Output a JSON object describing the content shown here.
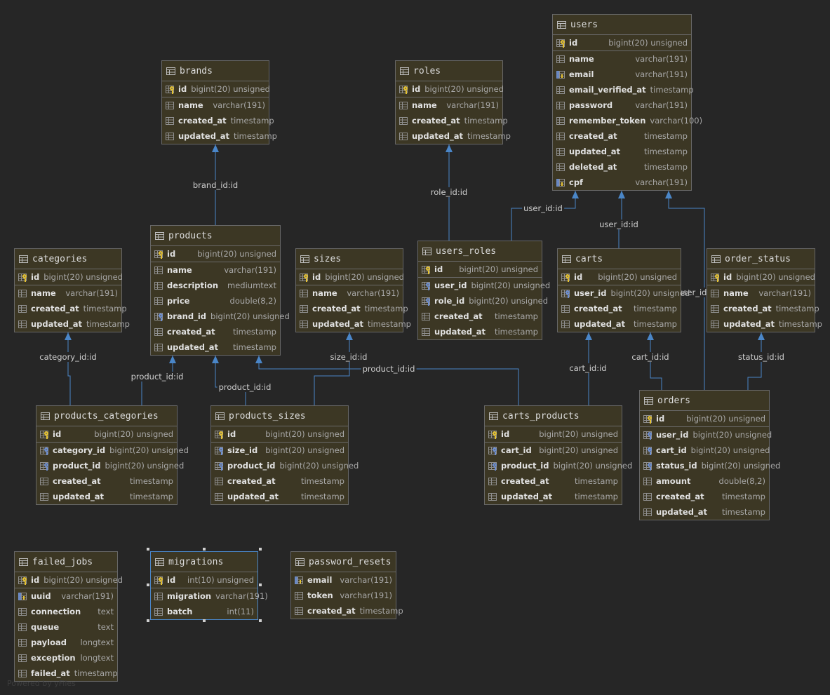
{
  "tables": {
    "users": {
      "name": "users",
      "columns": [
        {
          "name": "id",
          "type": "bigint(20) unsigned",
          "key": "pk"
        },
        {
          "name": "name",
          "type": "varchar(191)",
          "key": ""
        },
        {
          "name": "email",
          "type": "varchar(191)",
          "key": "idx"
        },
        {
          "name": "email_verified_at",
          "type": "timestamp",
          "key": ""
        },
        {
          "name": "password",
          "type": "varchar(191)",
          "key": ""
        },
        {
          "name": "remember_token",
          "type": "varchar(100)",
          "key": ""
        },
        {
          "name": "created_at",
          "type": "timestamp",
          "key": ""
        },
        {
          "name": "updated_at",
          "type": "timestamp",
          "key": ""
        },
        {
          "name": "deleted_at",
          "type": "timestamp",
          "key": ""
        },
        {
          "name": "cpf",
          "type": "varchar(191)",
          "key": "idx"
        }
      ]
    },
    "brands": {
      "name": "brands",
      "columns": [
        {
          "name": "id",
          "type": "bigint(20) unsigned",
          "key": "pk"
        },
        {
          "name": "name",
          "type": "varchar(191)",
          "key": ""
        },
        {
          "name": "created_at",
          "type": "timestamp",
          "key": ""
        },
        {
          "name": "updated_at",
          "type": "timestamp",
          "key": ""
        }
      ]
    },
    "roles": {
      "name": "roles",
      "columns": [
        {
          "name": "id",
          "type": "bigint(20) unsigned",
          "key": "pk"
        },
        {
          "name": "name",
          "type": "varchar(191)",
          "key": ""
        },
        {
          "name": "created_at",
          "type": "timestamp",
          "key": ""
        },
        {
          "name": "updated_at",
          "type": "timestamp",
          "key": ""
        }
      ]
    },
    "products": {
      "name": "products",
      "columns": [
        {
          "name": "id",
          "type": "bigint(20) unsigned",
          "key": "pk"
        },
        {
          "name": "name",
          "type": "varchar(191)",
          "key": ""
        },
        {
          "name": "description",
          "type": "mediumtext",
          "key": ""
        },
        {
          "name": "price",
          "type": "double(8,2)",
          "key": ""
        },
        {
          "name": "brand_id",
          "type": "bigint(20) unsigned",
          "key": "fk"
        },
        {
          "name": "created_at",
          "type": "timestamp",
          "key": ""
        },
        {
          "name": "updated_at",
          "type": "timestamp",
          "key": ""
        }
      ]
    },
    "categories": {
      "name": "categories",
      "columns": [
        {
          "name": "id",
          "type": "bigint(20) unsigned",
          "key": "pk"
        },
        {
          "name": "name",
          "type": "varchar(191)",
          "key": ""
        },
        {
          "name": "created_at",
          "type": "timestamp",
          "key": ""
        },
        {
          "name": "updated_at",
          "type": "timestamp",
          "key": ""
        }
      ]
    },
    "sizes": {
      "name": "sizes",
      "columns": [
        {
          "name": "id",
          "type": "bigint(20) unsigned",
          "key": "pk"
        },
        {
          "name": "name",
          "type": "varchar(191)",
          "key": ""
        },
        {
          "name": "created_at",
          "type": "timestamp",
          "key": ""
        },
        {
          "name": "updated_at",
          "type": "timestamp",
          "key": ""
        }
      ]
    },
    "users_roles": {
      "name": "users_roles",
      "columns": [
        {
          "name": "id",
          "type": "bigint(20) unsigned",
          "key": "pk"
        },
        {
          "name": "user_id",
          "type": "bigint(20) unsigned",
          "key": "fk"
        },
        {
          "name": "role_id",
          "type": "bigint(20) unsigned",
          "key": "fk"
        },
        {
          "name": "created_at",
          "type": "timestamp",
          "key": ""
        },
        {
          "name": "updated_at",
          "type": "timestamp",
          "key": ""
        }
      ]
    },
    "carts": {
      "name": "carts",
      "columns": [
        {
          "name": "id",
          "type": "bigint(20) unsigned",
          "key": "pk"
        },
        {
          "name": "user_id",
          "type": "bigint(20) unsigned",
          "key": "fk"
        },
        {
          "name": "created_at",
          "type": "timestamp",
          "key": ""
        },
        {
          "name": "updated_at",
          "type": "timestamp",
          "key": ""
        }
      ]
    },
    "order_status": {
      "name": "order_status",
      "columns": [
        {
          "name": "id",
          "type": "bigint(20) unsigned",
          "key": "pk"
        },
        {
          "name": "name",
          "type": "varchar(191)",
          "key": ""
        },
        {
          "name": "created_at",
          "type": "timestamp",
          "key": ""
        },
        {
          "name": "updated_at",
          "type": "timestamp",
          "key": ""
        }
      ]
    },
    "products_categories": {
      "name": "products_categories",
      "columns": [
        {
          "name": "id",
          "type": "bigint(20) unsigned",
          "key": "pk"
        },
        {
          "name": "category_id",
          "type": "bigint(20) unsigned",
          "key": "fk"
        },
        {
          "name": "product_id",
          "type": "bigint(20) unsigned",
          "key": "fk"
        },
        {
          "name": "created_at",
          "type": "timestamp",
          "key": ""
        },
        {
          "name": "updated_at",
          "type": "timestamp",
          "key": ""
        }
      ]
    },
    "products_sizes": {
      "name": "products_sizes",
      "columns": [
        {
          "name": "id",
          "type": "bigint(20) unsigned",
          "key": "pk"
        },
        {
          "name": "size_id",
          "type": "bigint(20) unsigned",
          "key": "fk"
        },
        {
          "name": "product_id",
          "type": "bigint(20) unsigned",
          "key": "fk"
        },
        {
          "name": "created_at",
          "type": "timestamp",
          "key": ""
        },
        {
          "name": "updated_at",
          "type": "timestamp",
          "key": ""
        }
      ]
    },
    "carts_products": {
      "name": "carts_products",
      "columns": [
        {
          "name": "id",
          "type": "bigint(20) unsigned",
          "key": "pk"
        },
        {
          "name": "cart_id",
          "type": "bigint(20) unsigned",
          "key": "fk"
        },
        {
          "name": "product_id",
          "type": "bigint(20) unsigned",
          "key": "fk"
        },
        {
          "name": "created_at",
          "type": "timestamp",
          "key": ""
        },
        {
          "name": "updated_at",
          "type": "timestamp",
          "key": ""
        }
      ]
    },
    "orders": {
      "name": "orders",
      "columns": [
        {
          "name": "id",
          "type": "bigint(20) unsigned",
          "key": "pk"
        },
        {
          "name": "user_id",
          "type": "bigint(20) unsigned",
          "key": "fk"
        },
        {
          "name": "cart_id",
          "type": "bigint(20) unsigned",
          "key": "fk"
        },
        {
          "name": "status_id",
          "type": "bigint(20) unsigned",
          "key": "fk"
        },
        {
          "name": "amount",
          "type": "double(8,2)",
          "key": ""
        },
        {
          "name": "created_at",
          "type": "timestamp",
          "key": ""
        },
        {
          "name": "updated_at",
          "type": "timestamp",
          "key": ""
        }
      ]
    },
    "failed_jobs": {
      "name": "failed_jobs",
      "columns": [
        {
          "name": "id",
          "type": "bigint(20) unsigned",
          "key": "pk"
        },
        {
          "name": "uuid",
          "type": "varchar(191)",
          "key": "idx"
        },
        {
          "name": "connection",
          "type": "text",
          "key": ""
        },
        {
          "name": "queue",
          "type": "text",
          "key": ""
        },
        {
          "name": "payload",
          "type": "longtext",
          "key": ""
        },
        {
          "name": "exception",
          "type": "longtext",
          "key": ""
        },
        {
          "name": "failed_at",
          "type": "timestamp",
          "key": ""
        }
      ]
    },
    "migrations": {
      "name": "migrations",
      "columns": [
        {
          "name": "id",
          "type": "int(10) unsigned",
          "key": "pk"
        },
        {
          "name": "migration",
          "type": "varchar(191)",
          "key": ""
        },
        {
          "name": "batch",
          "type": "int(11)",
          "key": ""
        }
      ]
    },
    "password_resets": {
      "name": "password_resets",
      "columns": [
        {
          "name": "email",
          "type": "varchar(191)",
          "key": "idx"
        },
        {
          "name": "token",
          "type": "varchar(191)",
          "key": ""
        },
        {
          "name": "created_at",
          "type": "timestamp",
          "key": ""
        }
      ]
    }
  },
  "relations": [
    {
      "label": "brand_id:id",
      "from": "products",
      "to": "brands"
    },
    {
      "label": "role_id:id",
      "from": "users_roles",
      "to": "roles"
    },
    {
      "label": "user_id:id",
      "from": "users_roles",
      "to": "users"
    },
    {
      "label": "user_id:id",
      "from": "carts",
      "to": "users"
    },
    {
      "label": "user_id:id",
      "from": "orders",
      "to": "users"
    },
    {
      "label": "category_id:id",
      "from": "products_categories",
      "to": "categories"
    },
    {
      "label": "product_id:id",
      "from": "products_categories",
      "to": "products"
    },
    {
      "label": "product_id:id",
      "from": "products_sizes",
      "to": "products"
    },
    {
      "label": "size_id:id",
      "from": "products_sizes",
      "to": "sizes"
    },
    {
      "label": "product_id:id",
      "from": "carts_products",
      "to": "products"
    },
    {
      "label": "cart_id:id",
      "from": "carts_products",
      "to": "carts"
    },
    {
      "label": "cart_id:id",
      "from": "orders",
      "to": "carts"
    },
    {
      "label": "status_id:id",
      "from": "orders",
      "to": "order_status"
    }
  ],
  "colors": {
    "accent": "#4a86c8",
    "table_bg": "#3c3724",
    "background": "#262626"
  },
  "watermark": "Powered by yFiles"
}
